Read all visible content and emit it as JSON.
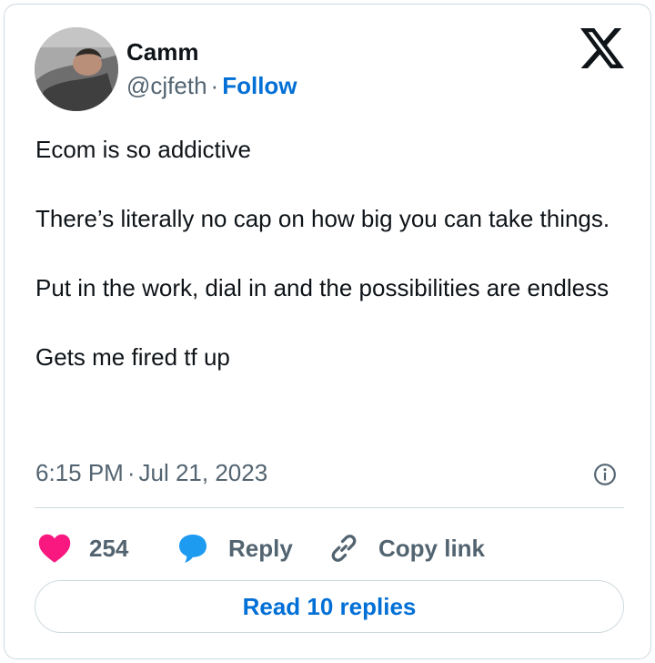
{
  "author": {
    "name": "Camm",
    "handle": "@cjfeth",
    "separator": "·",
    "follow_label": "Follow"
  },
  "logo_icon": "x-logo-icon",
  "tweet": {
    "paragraphs": [
      "Ecom is so addictive",
      "There’s literally no cap on how big you can take things.",
      "Put in the work, dial in and the possibilities are endless",
      "Gets me fired tf up"
    ],
    "time": "6:15 PM",
    "separator": "·",
    "date": "Jul 21, 2023"
  },
  "actions": {
    "likes_count": "254",
    "reply_label": "Reply",
    "copy_link_label": "Copy link"
  },
  "read_replies_label": "Read 10 replies",
  "colors": {
    "accent": "#006fd6",
    "heart": "#f91880",
    "reply_bubble": "#1d9bf0",
    "muted_text": "#536471",
    "border": "#cfd9de"
  }
}
